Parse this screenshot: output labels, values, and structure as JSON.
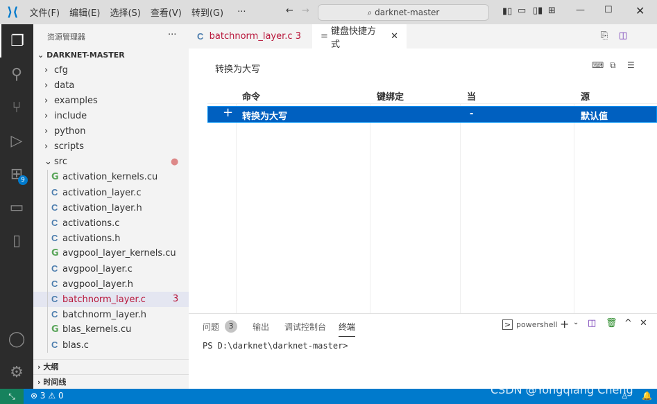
{
  "titlebar": {
    "menus": [
      "文件(F)",
      "编辑(E)",
      "选择(S)",
      "查看(V)",
      "转到(G)",
      "···"
    ],
    "search": "darknet-master"
  },
  "activity": {
    "extensions_badge": "9"
  },
  "sidebar": {
    "title": "资源管理器",
    "more": "···",
    "root": "DARKNET-MASTER",
    "folders": [
      "cfg",
      "data",
      "examples",
      "include",
      "python",
      "scripts",
      "src"
    ],
    "files": [
      {
        "name": "activation_kernels.cu",
        "type": "cu"
      },
      {
        "name": "activation_layer.c",
        "type": "c"
      },
      {
        "name": "activation_layer.h",
        "type": "c"
      },
      {
        "name": "activations.c",
        "type": "c"
      },
      {
        "name": "activations.h",
        "type": "c"
      },
      {
        "name": "avgpool_layer_kernels.cu",
        "type": "cu"
      },
      {
        "name": "avgpool_layer.c",
        "type": "c"
      },
      {
        "name": "avgpool_layer.h",
        "type": "c"
      },
      {
        "name": "batchnorm_layer.c",
        "type": "c",
        "badge": "3",
        "selected": true
      },
      {
        "name": "batchnorm_layer.h",
        "type": "c"
      },
      {
        "name": "blas_kernels.cu",
        "type": "cu"
      },
      {
        "name": "blas.c",
        "type": "c"
      }
    ],
    "outline": "大纲",
    "timeline": "时间线"
  },
  "tabs": [
    {
      "label": "batchnorm_layer.c",
      "badge": "3"
    },
    {
      "label": "键盘快捷方式",
      "active": true
    }
  ],
  "keybindings": {
    "search_value": "转换为大写",
    "headers": [
      "命令",
      "键绑定",
      "当",
      "源"
    ],
    "rows": [
      {
        "command": "转换为大写",
        "keybinding": "",
        "when": "-",
        "source": "默认值"
      }
    ]
  },
  "panel": {
    "tabs": [
      "问题",
      "输出",
      "调试控制台",
      "终端"
    ],
    "problems_count": "3",
    "shell": "powershell",
    "terminal_line": "PS D:\\darknet\\darknet-master>"
  },
  "status": {
    "errors": "3",
    "warnings": "0",
    "watermark": "CSDN @Yongqiang Cheng"
  },
  "colors": {
    "accent": "#007acc",
    "selection": "#0060c0"
  }
}
